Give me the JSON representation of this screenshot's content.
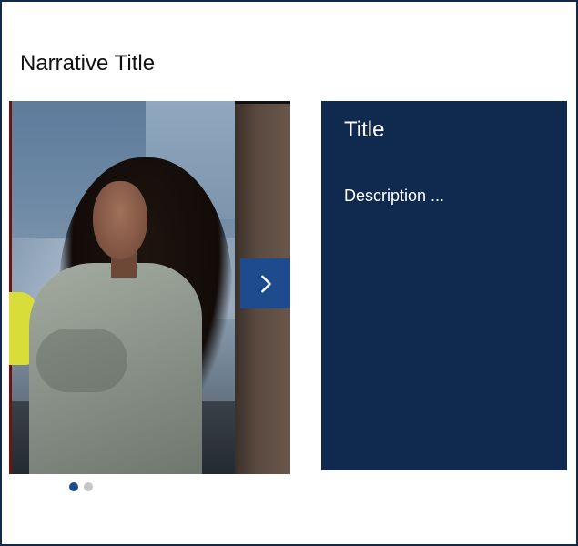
{
  "narrative": {
    "title": "Narrative Title"
  },
  "carousel": {
    "image_description": "woman-with-curly-hair-in-work-jacket",
    "next_icon": "chevron-right-icon",
    "dots_count": 2,
    "active_dot": 1
  },
  "card": {
    "title": "Title",
    "description": "Description ..."
  },
  "colors": {
    "frame_border": "#13294b",
    "card_background": "#0f2a4e",
    "accent_blue": "#1e4b8e",
    "inactive_dot": "#c6c6c6",
    "text_light": "#ffffff",
    "text_dark": "#111111"
  }
}
